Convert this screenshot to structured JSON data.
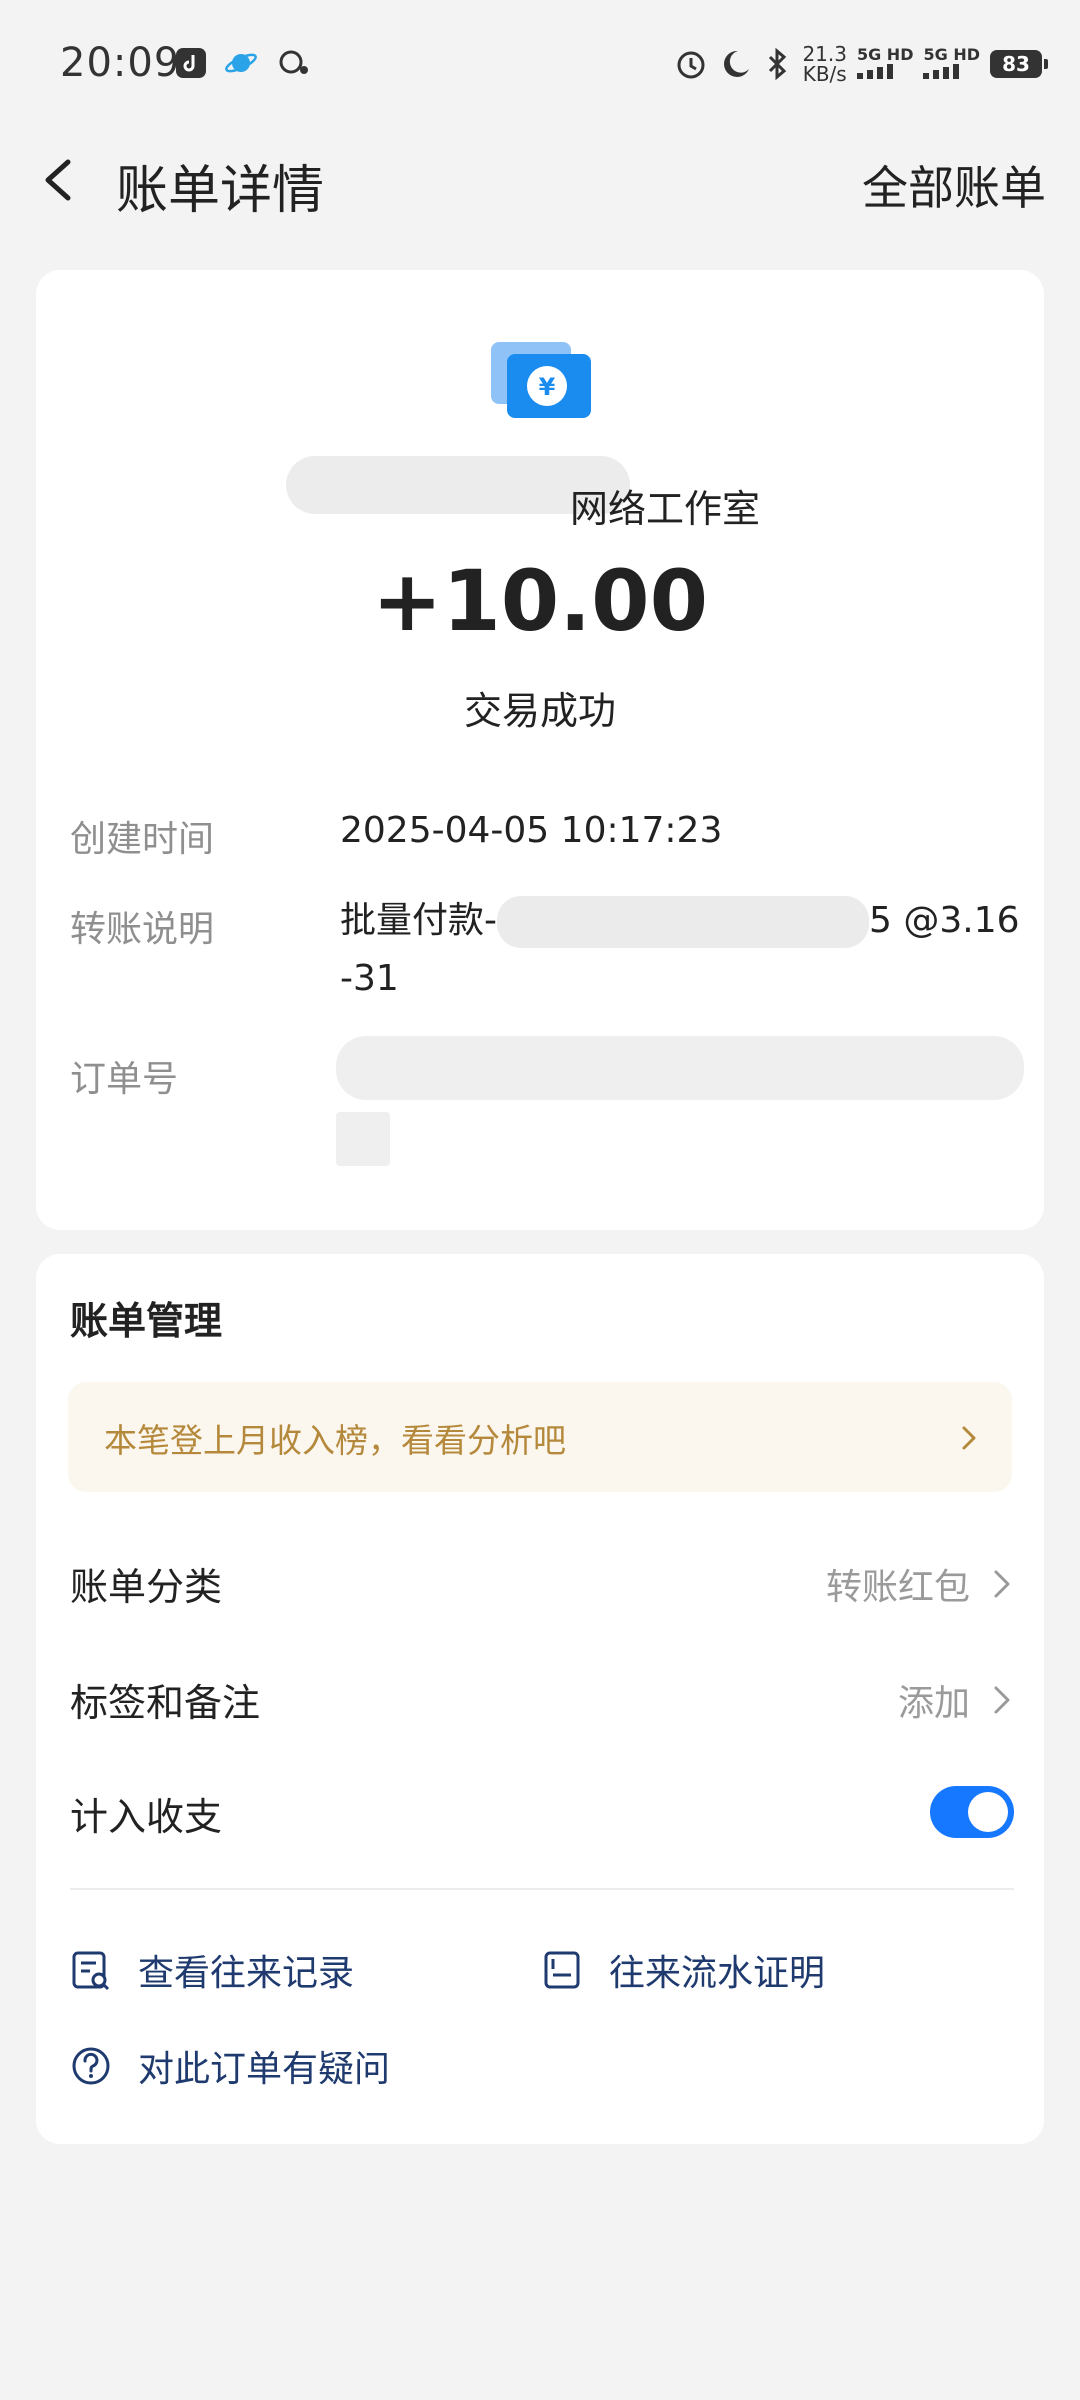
{
  "status_bar": {
    "time": "20:09",
    "speed_value": "21.3",
    "speed_unit": "KB/s",
    "sim1": "5G HD",
    "sim2": "5G HD",
    "battery": "83"
  },
  "header": {
    "title": "账单详情",
    "all_bills": "全部账单"
  },
  "detail": {
    "merchant_name_suffix": "网络工作室",
    "amount": "+10.00",
    "status": "交易成功",
    "fields": [
      {
        "label": "创建时间",
        "value": "2025-04-05 10:17:23"
      },
      {
        "label": "转账说明",
        "value_prefix": "批量付款-",
        "value_suffix": "5 @3.16",
        "value_line2": "-31"
      },
      {
        "label": "订单号",
        "value": ""
      }
    ]
  },
  "manage": {
    "title": "账单管理",
    "promo": "本笔登上月收入榜，看看分析吧",
    "category_label": "账单分类",
    "category_value": "转账红包",
    "tags_label": "标签和备注",
    "tags_value": "添加",
    "include_label": "计入收支",
    "include_enabled": true,
    "actions": {
      "records": "查看往来记录",
      "proof": "往来流水证明",
      "question": "对此订单有疑问"
    }
  },
  "colors": {
    "accent": "#1677ff",
    "promo_text": "#b5893b",
    "promo_bg": "#fbf6ee",
    "link": "#1f3a6e"
  },
  "icons": {
    "back": "chevron-left-icon",
    "transfer": "yuan-transfer-icon",
    "chevron": "chevron-right-icon",
    "records": "receipt-search-icon",
    "proof": "document-icon",
    "question": "question-circle-icon"
  }
}
